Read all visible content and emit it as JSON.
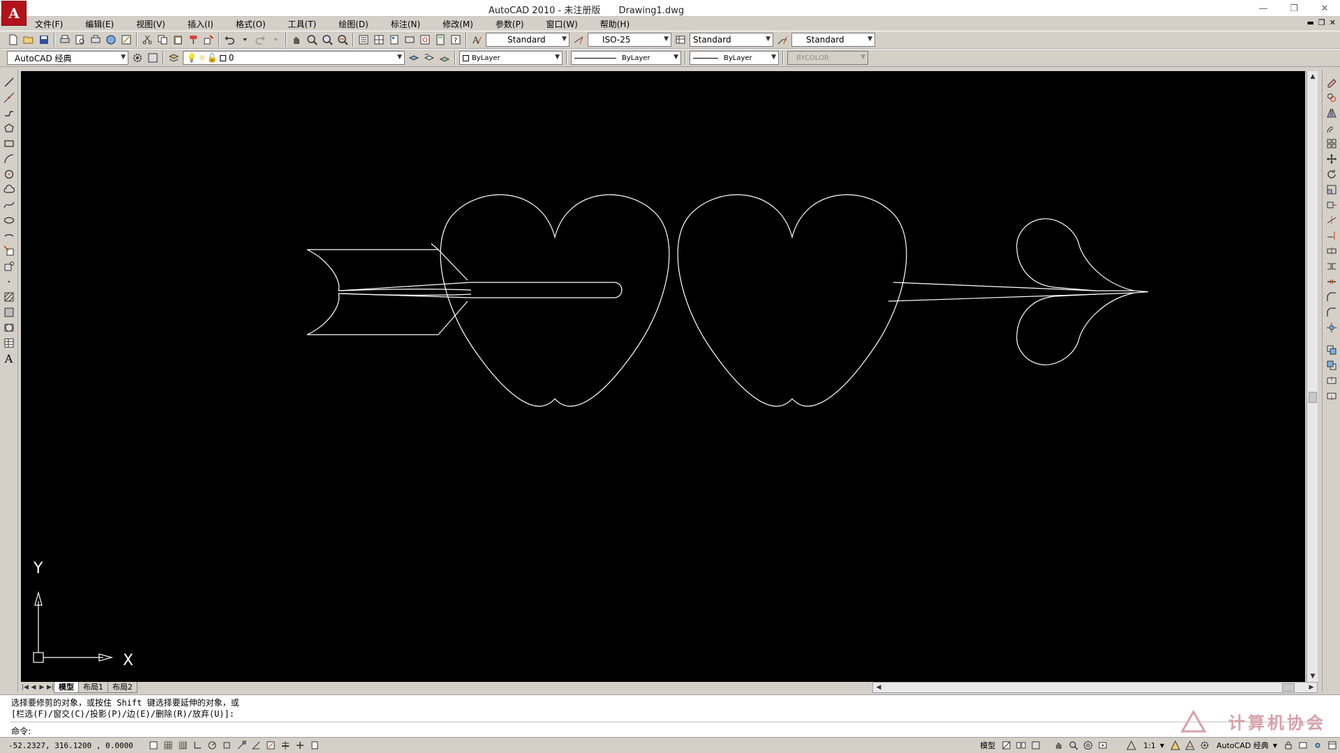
{
  "window": {
    "title": "AutoCAD 2010 - 未注册版",
    "document": "Drawing1.dwg",
    "logo_letter": "A",
    "controls": [
      "minimize",
      "restore",
      "close"
    ]
  },
  "menu": [
    {
      "label": "文件(F)"
    },
    {
      "label": "编辑(E)"
    },
    {
      "label": "视图(V)"
    },
    {
      "label": "插入(I)"
    },
    {
      "label": "格式(O)"
    },
    {
      "label": "工具(T)"
    },
    {
      "label": "绘图(D)"
    },
    {
      "label": "标注(N)"
    },
    {
      "label": "修改(M)"
    },
    {
      "label": "参数(P)"
    },
    {
      "label": "窗口(W)"
    },
    {
      "label": "帮助(H)"
    }
  ],
  "toolbar": {
    "text_style": "Standard",
    "dim_style": "ISO-25",
    "table_style": "Standard",
    "multileader_style": "Standard",
    "workspace": "AutoCAD 经典",
    "layer": "0",
    "color": "ByLayer",
    "linetype": "ByLayer",
    "lineweight": "ByLayer",
    "plotstyle": "BYCOLOR"
  },
  "left_palette": {
    "text_tool": "A"
  },
  "ucs": {
    "x_label": "X",
    "y_label": "Y"
  },
  "tabs": [
    {
      "label": "模型",
      "active": true
    },
    {
      "label": "布局1",
      "active": false
    },
    {
      "label": "布局2",
      "active": false
    }
  ],
  "command": {
    "line1": "选择要修剪的对象，或按住 Shift 键选择要延伸的对象，或",
    "line2": "[栏选(F)/窗交(C)/投影(P)/边(E)/删除(R)/放弃(U)]:",
    "prompt": "命令:",
    "watermark": "计算机协会"
  },
  "status": {
    "coordinates": "-52.2327,  316.1200 , 0.0000",
    "model_label": "模型",
    "annotation_scale": "1:1",
    "workspace_label": "AutoCAD 经典"
  },
  "colors": {
    "canvas_bg": "#000000",
    "drawing_stroke": "#ffffff",
    "chrome": "#d4d0c8",
    "logo": "#b3121a"
  }
}
